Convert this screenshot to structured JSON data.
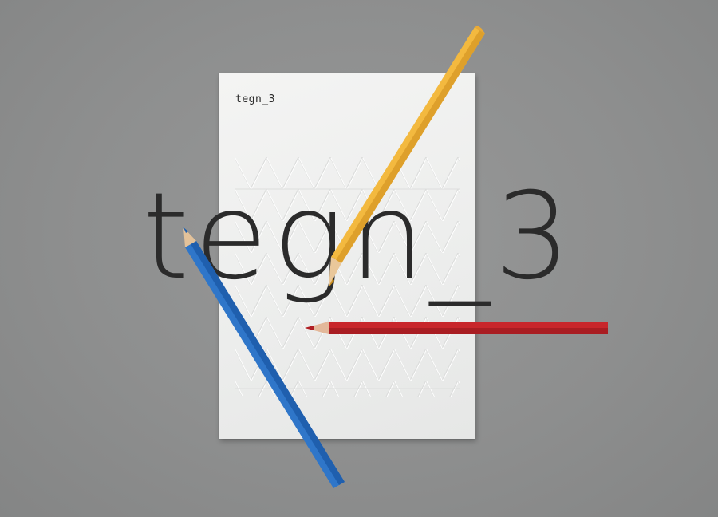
{
  "card": {
    "label": "tegn_3"
  },
  "headline": {
    "text": "tegn_3"
  },
  "pencils": [
    {
      "name": "yellow-pencil",
      "color": "#f2b63b"
    },
    {
      "name": "blue-pencil",
      "color": "#2f76c9"
    },
    {
      "name": "red-pencil",
      "color": "#c8262b"
    }
  ],
  "colors": {
    "background": "#8d8e8e",
    "card": "#efefee",
    "text": "#2b2b2b"
  }
}
